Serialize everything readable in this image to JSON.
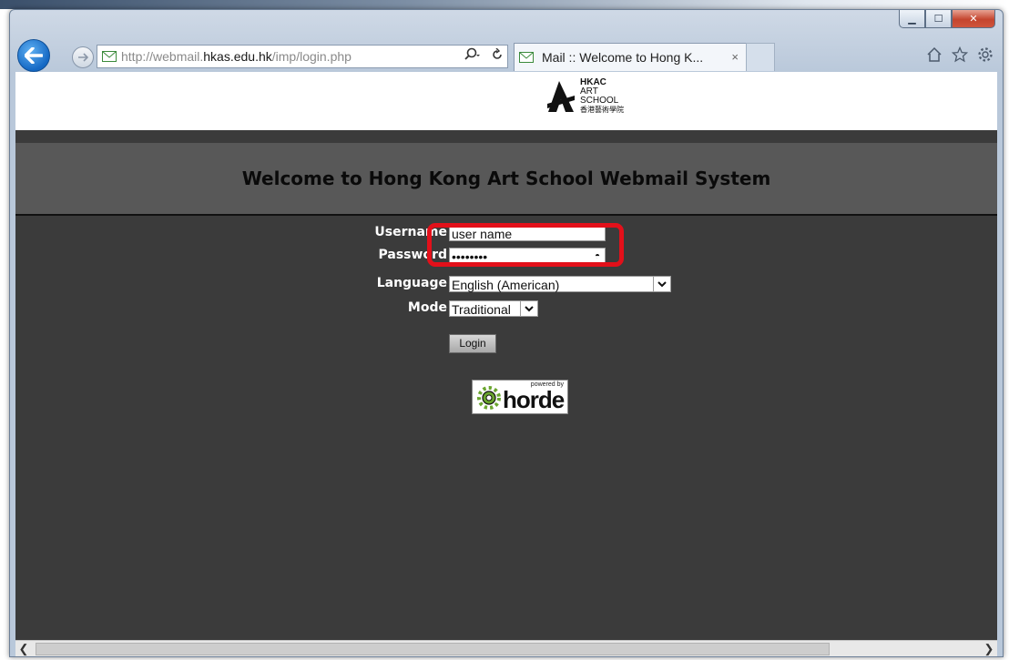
{
  "browser": {
    "url_prefix": "http://webmail.",
    "url_domain": "hkas.edu.hk",
    "url_path": "/imp/login.php",
    "tab_title": "Mail :: Welcome to Hong K...",
    "tab_close": "×"
  },
  "site": {
    "logo": {
      "line1": "HKAC",
      "line2": "ART",
      "line3": "SCHOOL",
      "line4": "香港藝術學院"
    },
    "welcome_title": "Welcome to Hong Kong Art School Webmail System"
  },
  "login_form": {
    "username_label": "Username",
    "username_value": "user name",
    "password_label": "Password",
    "password_value": "••••••••",
    "language_label": "Language",
    "language_value": "English (American)",
    "mode_label": "Mode",
    "mode_value": "Traditional",
    "login_button": "Login"
  },
  "horde": {
    "powered_by": "powered by",
    "name": "horde"
  },
  "colors": {
    "page_bg": "#3b3b3b",
    "band_bg": "#585858",
    "highlight": "#e3101a"
  }
}
